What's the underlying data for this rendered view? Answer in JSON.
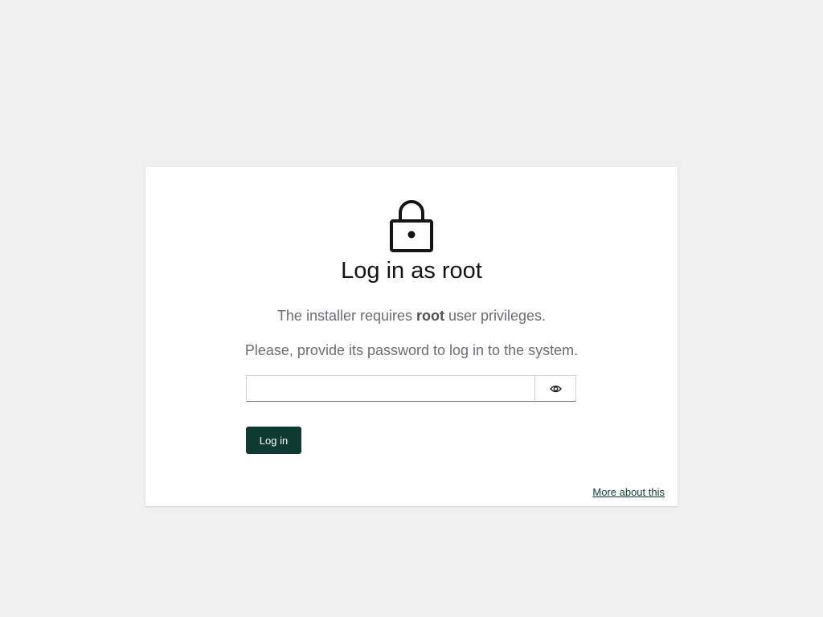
{
  "card": {
    "icon": "lock-icon",
    "title": "Log in as root",
    "description_prefix": "The installer requires ",
    "description_bold": "root",
    "description_suffix": " user privileges.",
    "instruction": "Please, provide its password to log in to the system."
  },
  "password": {
    "value": "",
    "placeholder": "",
    "toggle_icon": "eye-icon"
  },
  "buttons": {
    "login_label": "Log in"
  },
  "links": {
    "more_label": "More about this"
  },
  "colors": {
    "background": "#f0f0f0",
    "card": "#ffffff",
    "primary_button": "#0f3a32",
    "link": "#0f3a32",
    "muted_text": "#6a6e73"
  }
}
